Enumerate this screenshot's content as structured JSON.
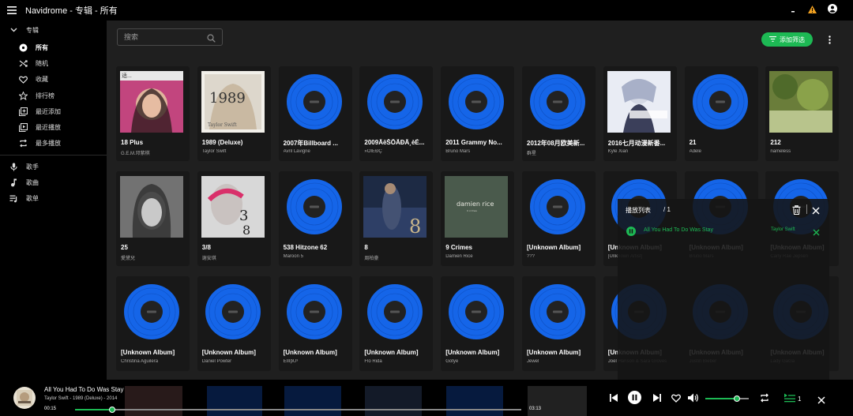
{
  "app": {
    "title": "Navidrome - 专辑 - 所有"
  },
  "sidebar": {
    "albums_group": "专辑",
    "items": [
      {
        "label": "所有",
        "icon": "album-icon"
      },
      {
        "label": "随机",
        "icon": "shuffle-icon"
      },
      {
        "label": "收藏",
        "icon": "heart-icon"
      },
      {
        "label": "排行榜",
        "icon": "star-icon"
      },
      {
        "label": "最近添加",
        "icon": "library-add-icon"
      },
      {
        "label": "最近播放",
        "icon": "video-library-icon"
      },
      {
        "label": "最多播放",
        "icon": "repeat-icon"
      }
    ],
    "links": [
      {
        "label": "歌手",
        "icon": "mic-icon"
      },
      {
        "label": "歌曲",
        "icon": "music-note-icon"
      },
      {
        "label": "歌单",
        "icon": "playlist-icon"
      }
    ]
  },
  "toolbar": {
    "search_placeholder": "搜索",
    "filter_label": "添加筛选"
  },
  "albums": [
    {
      "title": "18 Plus",
      "artist": "G.E.M.邓紫棋",
      "cover": "photo-pink",
      "badge": "适..."
    },
    {
      "title": "1989 (Deluxe)",
      "artist": "Taylor Swift",
      "cover": "photo-1989"
    },
    {
      "title": "2007年Billboard ...",
      "artist": "Avril Lavigne",
      "cover": "disc"
    },
    {
      "title": "2009ÄëŠÔÃÐÂ¸èÈ...",
      "artist": "»ÓÎÈÐÇ",
      "cover": "disc"
    },
    {
      "title": "2011 Grammy No...",
      "artist": "Bruno Mars",
      "cover": "disc"
    },
    {
      "title": "2012年08月欧美新...",
      "artist": "群星",
      "cover": "disc"
    },
    {
      "title": "2016七月动漫新番...",
      "artist": "Kyle Xian",
      "cover": "photo-anime"
    },
    {
      "title": "21",
      "artist": "Adele",
      "cover": "disc"
    },
    {
      "title": "212",
      "artist": "nameless",
      "cover": "photo-green"
    },
    {
      "title": "25",
      "artist": "愛黛兒",
      "cover": "photo-adele"
    },
    {
      "title": "3/8",
      "artist": "谢安琪",
      "cover": "photo-38"
    },
    {
      "title": "538 Hitzone 62",
      "artist": "Maroon 5",
      "cover": "disc"
    },
    {
      "title": "8",
      "artist": "周柏豪",
      "cover": "photo-8"
    },
    {
      "title": "9 Crimes",
      "artist": "Damien Rice",
      "cover": "photo-damien"
    },
    {
      "title": "[Unknown Album]",
      "artist": "???",
      "cover": "disc"
    },
    {
      "title": "[Unknown Album]",
      "artist": "[Unknown Artist]",
      "cover": "disc"
    },
    {
      "title": "[Unknown Album]",
      "artist": "Bruno Mars",
      "cover": "disc"
    },
    {
      "title": "[Unknown Album]",
      "artist": "Carly Rae Jepsen",
      "cover": "disc"
    },
    {
      "title": "[Unknown Album]",
      "artist": "Christina Aguilera",
      "cover": "disc"
    },
    {
      "title": "[Unknown Album]",
      "artist": "Daniel Powter",
      "cover": "disc"
    },
    {
      "title": "[Unknown Album]",
      "artist": "ÈÎÏÍþÚ³",
      "cover": "disc"
    },
    {
      "title": "[Unknown Album]",
      "artist": "Flo Rida",
      "cover": "disc"
    },
    {
      "title": "[Unknown Album]",
      "artist": "Gotye",
      "cover": "disc"
    },
    {
      "title": "[Unknown Album]",
      "artist": "Jewel",
      "cover": "disc"
    },
    {
      "title": "[Unknown Album]",
      "artist": "Joel Hanson & Sara Groves",
      "cover": "disc"
    },
    {
      "title": "[Unknown Album]",
      "artist": "Justin Bieber",
      "cover": "disc"
    },
    {
      "title": "[Unknown Album]",
      "artist": "Lady GaGa",
      "cover": "disc"
    }
  ],
  "play_queue": {
    "title": "播放列表",
    "count": "/ 1",
    "items": [
      {
        "song": "All You Had To Do Was Stay",
        "artist": "Taylor Swift"
      }
    ]
  },
  "player": {
    "title": "All You Had To Do Was Stay",
    "subtitle": "Taylor Swift - 1989 (Deluxe) - 2014",
    "current_time": "00:15",
    "duration": "03:13",
    "progress": 0.084,
    "volume": 0.73,
    "queue_count": "1"
  },
  "colors": {
    "accent": "#1db954",
    "disc_blue": "#1565e8",
    "background": "#1f1f1f",
    "sidebar": "#000000",
    "card": "#181818"
  }
}
